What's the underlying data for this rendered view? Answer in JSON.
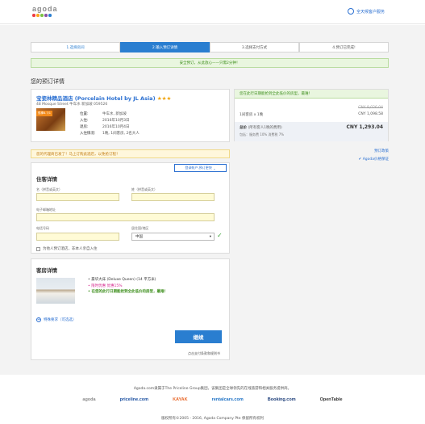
{
  "header": {
    "logo_text": "agoda",
    "logo_dot_colors": [
      "#ee3a41",
      "#f9a51a",
      "#7dc242",
      "#8a53a3",
      "#2a7ed0"
    ],
    "support_label": "全天候客户服务"
  },
  "steps": [
    {
      "label": "1.选择房间",
      "state": "done"
    },
    {
      "label": "2.输入预订详情",
      "state": "active"
    },
    {
      "label": "3.选择支付方式",
      "state": "pending"
    },
    {
      "label": "4.预订已完成!",
      "state": "pending"
    }
  ],
  "notice": "安全预订，从此放心——只需2分钟！",
  "page_title": "您的预订详情",
  "hotel": {
    "name": "宝瓷林精品酒店 (Porcelain Hotel by JL Asia)",
    "stars": "★★★",
    "address": "48 Mosque Street 牛车水 新加坡 059526",
    "badge": "很棒8.7/1",
    "info": [
      {
        "label": "位置:",
        "value": "牛车水, 新加坡"
      },
      {
        "label": "入住:",
        "value": "2016年10月3日"
      },
      {
        "label": "退房:",
        "value": "2016年10月4日"
      },
      {
        "label": "入住情况:",
        "value": "1晚, 1间客房, 2名大人"
      }
    ]
  },
  "price": {
    "header": "您在此行日期能抢到全此低价的房型，最难！",
    "original": "CNY 9,026.04",
    "row_label": "1间客房 x 1晚",
    "row_value": "CNY 1,098.58",
    "total_label": "总价",
    "total_note": "(所有客人1晚的费用)",
    "total_value": "CNY 1,293.04",
    "tax_note": "包括：服务费 10% 消费税 7%"
  },
  "right_links": {
    "policy": "预订政策",
    "guarantee": "Agoda价格保证"
  },
  "promo": "您的代理商已发了！马上订购此酒店，以免抢订程！",
  "form": {
    "login_link": "登录帐户,预订更快",
    "title": "住客详情",
    "first_name_label": "名（拼音或英文）",
    "last_name_label": "姓（拼音或英文）",
    "email_label": "电子邮箱地址",
    "phone_label": "电话号码",
    "country_label": "居住国/地区",
    "country_value": "中国",
    "other_guest_label": "为他人预订酒店，非本人亲自入住"
  },
  "room": {
    "title": "客房详情",
    "line1": "• 豪华大床 (Deluxe Queen) (14 平方米)",
    "line2": "• 限时优惠 优惠15%",
    "line3": "• 在您的此行日期能抢到全此低价的房型，最难！",
    "add_request": "特殊要求（可选选）"
  },
  "continue_label": "继续",
  "terms": "点击支付条款和规则书",
  "footer": {
    "text": "Agoda.com隶属于The Priceline Group集团，该集团是全球领先的在线旅游和相关服务提供商。",
    "brands": [
      {
        "name": "agoda",
        "color": "#8a8a8a"
      },
      {
        "name": "priceline.com",
        "color": "#1a4fa0"
      },
      {
        "name": "KAYAK",
        "color": "#e8682a"
      },
      {
        "name": "rentalcars.com",
        "color": "#1a6fc4"
      },
      {
        "name": "Booking.com",
        "color": "#1b3c78"
      },
      {
        "name": "OpenTable",
        "color": "#333333"
      }
    ],
    "copyright": "版权所有©2005 - 2016, Agoda Company Pte 保留所有权利"
  }
}
